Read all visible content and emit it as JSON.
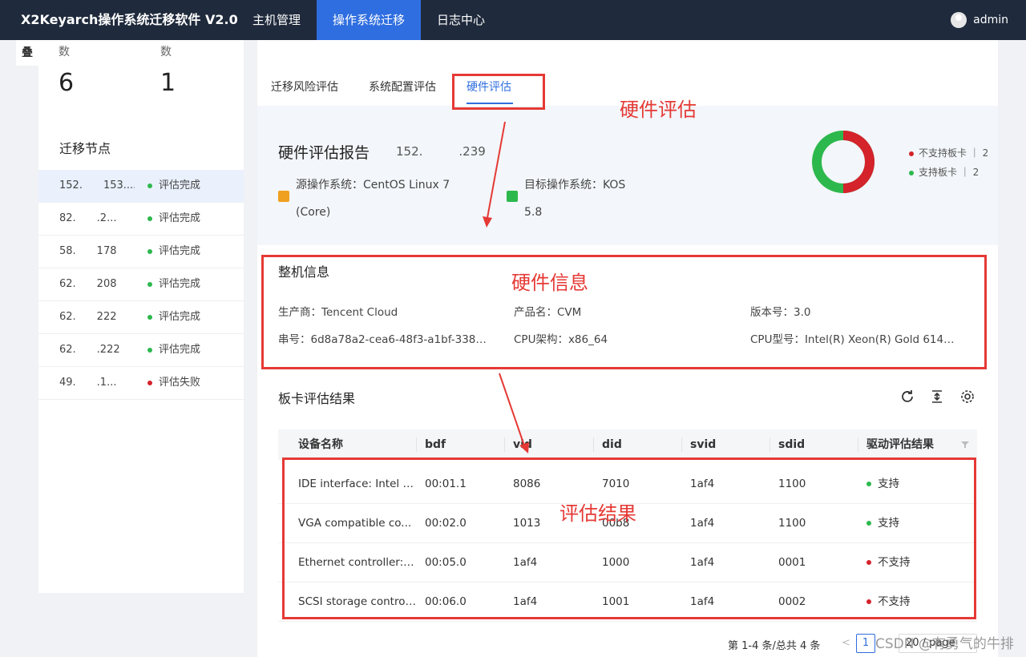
{
  "header": {
    "brand": "X2Keyarch操作系统迁移软件 V2.0",
    "nav": [
      "主机管理",
      "操作系统迁移",
      "日志中心"
    ],
    "user": "admin"
  },
  "sidebar": {
    "fold_label": "叠",
    "stats": [
      {
        "label": "数",
        "value": "6"
      },
      {
        "label": "数",
        "value": "1"
      }
    ],
    "nodes_title": "迁移节点",
    "nodes": [
      {
        "ip": "152.  153....",
        "status": "评估完成",
        "color": "#2db84d"
      },
      {
        "ip": "82.  .2...",
        "status": "评估完成",
        "color": "#2db84d"
      },
      {
        "ip": "58.  178",
        "status": "评估完成",
        "color": "#2db84d"
      },
      {
        "ip": "62.  208",
        "status": "评估完成",
        "color": "#2db84d"
      },
      {
        "ip": "62.  222",
        "status": "评估完成",
        "color": "#2db84d"
      },
      {
        "ip": "62.  .222",
        "status": "评估完成",
        "color": "#2db84d"
      },
      {
        "ip": "49.  .1...",
        "status": "评估失败",
        "color": "#d4232b"
      }
    ]
  },
  "tabs": [
    "迁移风险评估",
    "系统配置评估",
    "硬件评估"
  ],
  "report": {
    "title": "硬件评估报告",
    "ip": "152.   .239",
    "source_os_label": "源操作系统：CentOS Linux 7",
    "source_os_line2": "(Core)",
    "target_os_label": "目标操作系统：KOS",
    "target_os_line2": "5.8",
    "donut": {
      "unsupported": 2,
      "supported": 2
    },
    "legend": [
      {
        "label": "不支持板卡 ｜ 2",
        "color": "#d4232b"
      },
      {
        "label": "支持板卡 ｜ 2",
        "color": "#2db84d"
      }
    ]
  },
  "machine": {
    "title": "整机信息",
    "vendor": "生产商：Tencent Cloud",
    "product": "产品名：CVM",
    "version": "版本号：3.0",
    "serial": "串号：6d8a78a2-cea6-48f3-a1bf-338b...",
    "arch": "CPU架构：x86_64",
    "cpu": "CPU型号：Intel(R) Xeon(R) Gold 6148 ..."
  },
  "cards": {
    "title": "板卡评估结果",
    "columns": [
      "设备名称",
      "bdf",
      "vid",
      "did",
      "svid",
      "sdid",
      "驱动评估结果"
    ],
    "rows": [
      {
        "name": "IDE interface: Intel C...",
        "bdf": "00:01.1",
        "vid": "8086",
        "did": "7010",
        "svid": "1af4",
        "sdid": "1100",
        "result": "支持",
        "color": "#2db84d"
      },
      {
        "name": "VGA compatible co...",
        "bdf": "00:02.0",
        "vid": "1013",
        "did": "00b8",
        "svid": "1af4",
        "sdid": "1100",
        "result": "支持",
        "color": "#2db84d"
      },
      {
        "name": "Ethernet controller: ...",
        "bdf": "00:05.0",
        "vid": "1af4",
        "did": "1000",
        "svid": "1af4",
        "sdid": "0001",
        "result": "不支持",
        "color": "#d4232b"
      },
      {
        "name": "SCSI storage control...",
        "bdf": "00:06.0",
        "vid": "1af4",
        "did": "1001",
        "svid": "1af4",
        "sdid": "0002",
        "result": "不支持",
        "color": "#d4232b"
      }
    ]
  },
  "pagination": {
    "summary": "第 1-4 条/总共 4 条",
    "prev": "<",
    "page": "1",
    "size": "20 / page"
  },
  "annotations": [
    "硬件评估",
    "硬件信息",
    "评估结果"
  ],
  "watermark": "CSDN @有勇气的牛排"
}
